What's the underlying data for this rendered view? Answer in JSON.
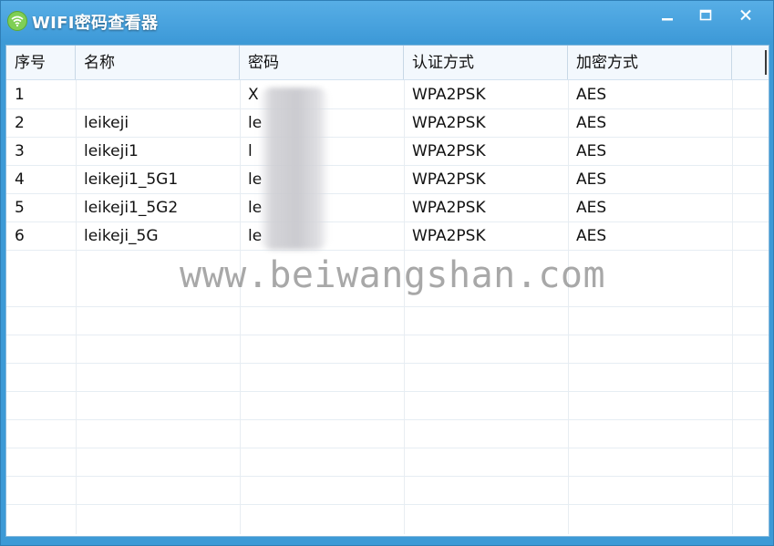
{
  "window": {
    "title": "WIFI密码查看器",
    "icon": "wifi-icon",
    "controls": [
      "minimize-icon",
      "maximize-icon",
      "close-icon"
    ],
    "accent": "#3d9ad6"
  },
  "table": {
    "columns": [
      "序号",
      "名称",
      "密码",
      "认证方式",
      "加密方式"
    ],
    "rows": [
      {
        "index": "1",
        "name": "",
        "password": "X",
        "auth": "WPA2PSK",
        "encryption": "AES"
      },
      {
        "index": "2",
        "name": "leikeji",
        "password": "le",
        "auth": "WPA2PSK",
        "encryption": "AES"
      },
      {
        "index": "3",
        "name": "leikeji1",
        "password": "l",
        "auth": "WPA2PSK",
        "encryption": "AES"
      },
      {
        "index": "4",
        "name": "leikeji1_5G1",
        "password": "le",
        "auth": "WPA2PSK",
        "encryption": "AES"
      },
      {
        "index": "5",
        "name": "leikeji1_5G2",
        "password": "le",
        "auth": "WPA2PSK",
        "encryption": "AES"
      },
      {
        "index": "6",
        "name": "leikeji_5G",
        "password": "le",
        "auth": "WPA2PSK",
        "encryption": "AES"
      }
    ]
  },
  "watermark": "www.beiwangshan.com"
}
